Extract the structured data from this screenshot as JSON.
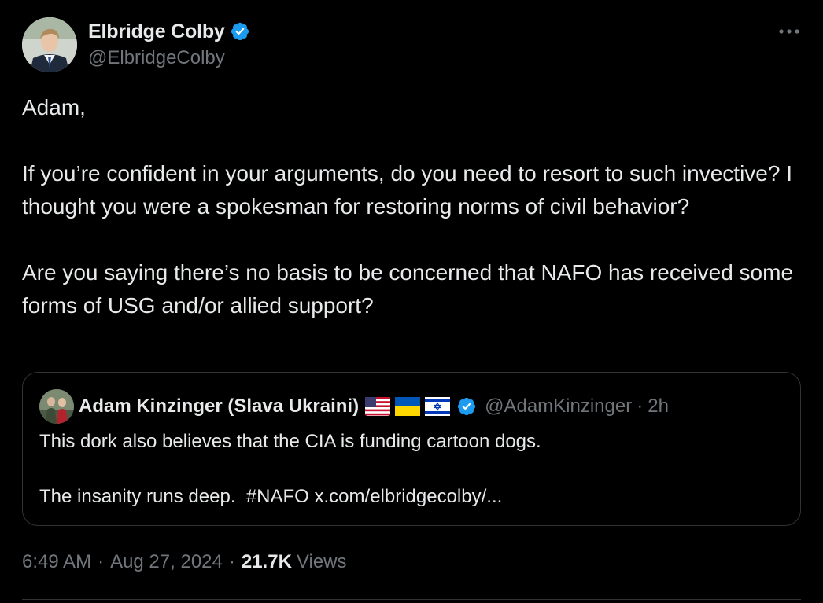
{
  "author": {
    "display_name": "Elbridge Colby",
    "handle": "@ElbridgeColby",
    "verified": true
  },
  "tweet": {
    "paragraphs": [
      "Adam,",
      "If you’re confident in your arguments, do you need to resort to such invective? I thought you were a spokesman for restoring norms of civil behavior?",
      "Are you saying there’s no basis to be concerned that NAFO has received some forms of USG and/or allied support?"
    ]
  },
  "quote": {
    "display_name": "Adam Kinzinger (Slava Ukraini)",
    "flags": [
      "us-flag-icon",
      "ukraine-flag-icon",
      "israel-flag-icon"
    ],
    "verified": true,
    "handle": "@AdamKinzinger",
    "separator": "·",
    "time": "2h",
    "line1": "This dork also believes that the CIA is funding cartoon dogs.",
    "line2_text": "The insanity runs deep.  ",
    "hashtag": "#NAFO",
    "link": "x.com/elbridgecolby/..."
  },
  "meta": {
    "time": "6:49 AM",
    "separator": "·",
    "date": "Aug 27, 2024",
    "views_count": "21.7K",
    "views_label": "Views"
  },
  "colors": {
    "background": "#000000",
    "text_primary": "#e7e9ea",
    "text_secondary": "#71767b",
    "border": "#2f3336",
    "verified_blue": "#1d9bf0"
  }
}
